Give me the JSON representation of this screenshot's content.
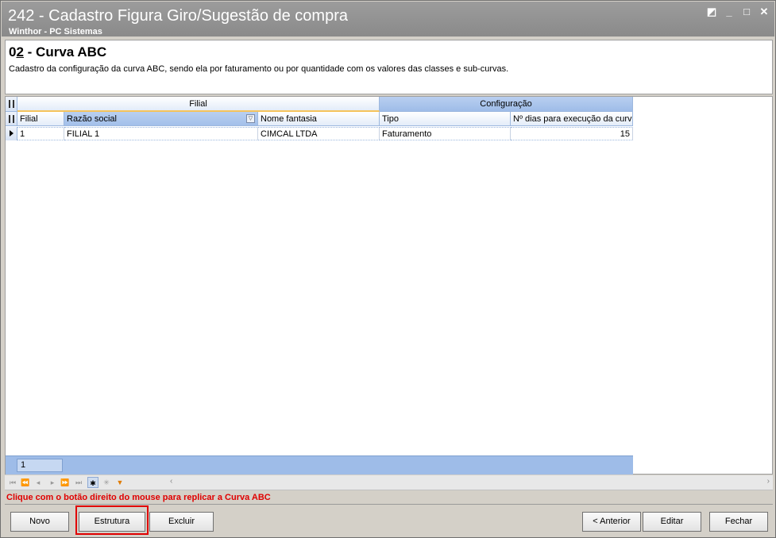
{
  "window": {
    "title": "242 - Cadastro Figura Giro/Sugestão de compra",
    "subtitle": "Winthor - PC Sistemas"
  },
  "header": {
    "title_num_a": "0",
    "title_num_b": "2",
    "title_text": " - Curva ABC",
    "description": "Cadastro da configuração da curva ABC, sendo ela por faturamento ou por quantidade com os valores das classes e sub-curvas."
  },
  "grid": {
    "bands": {
      "filial": "Filial",
      "config": "Configuração"
    },
    "columns": [
      "Filial",
      "Razão social",
      "Nome fantasia",
      "Tipo",
      "Nº dias para execução da curv"
    ],
    "rows": [
      {
        "filial": "1",
        "razao_social": "FILIAL 1",
        "nome_fantasia": "CIMCAL LTDA",
        "tipo": "Faturamento",
        "dias": "15"
      }
    ],
    "footer_count": "1"
  },
  "hint": "Clique com o botão direito do mouse para replicar a Curva ABC",
  "buttons": {
    "novo": "Novo",
    "estrutura": "Estrutura",
    "excluir": "Excluir",
    "anterior": "< Anterior",
    "editar": "Editar",
    "fechar": "Fechar"
  }
}
